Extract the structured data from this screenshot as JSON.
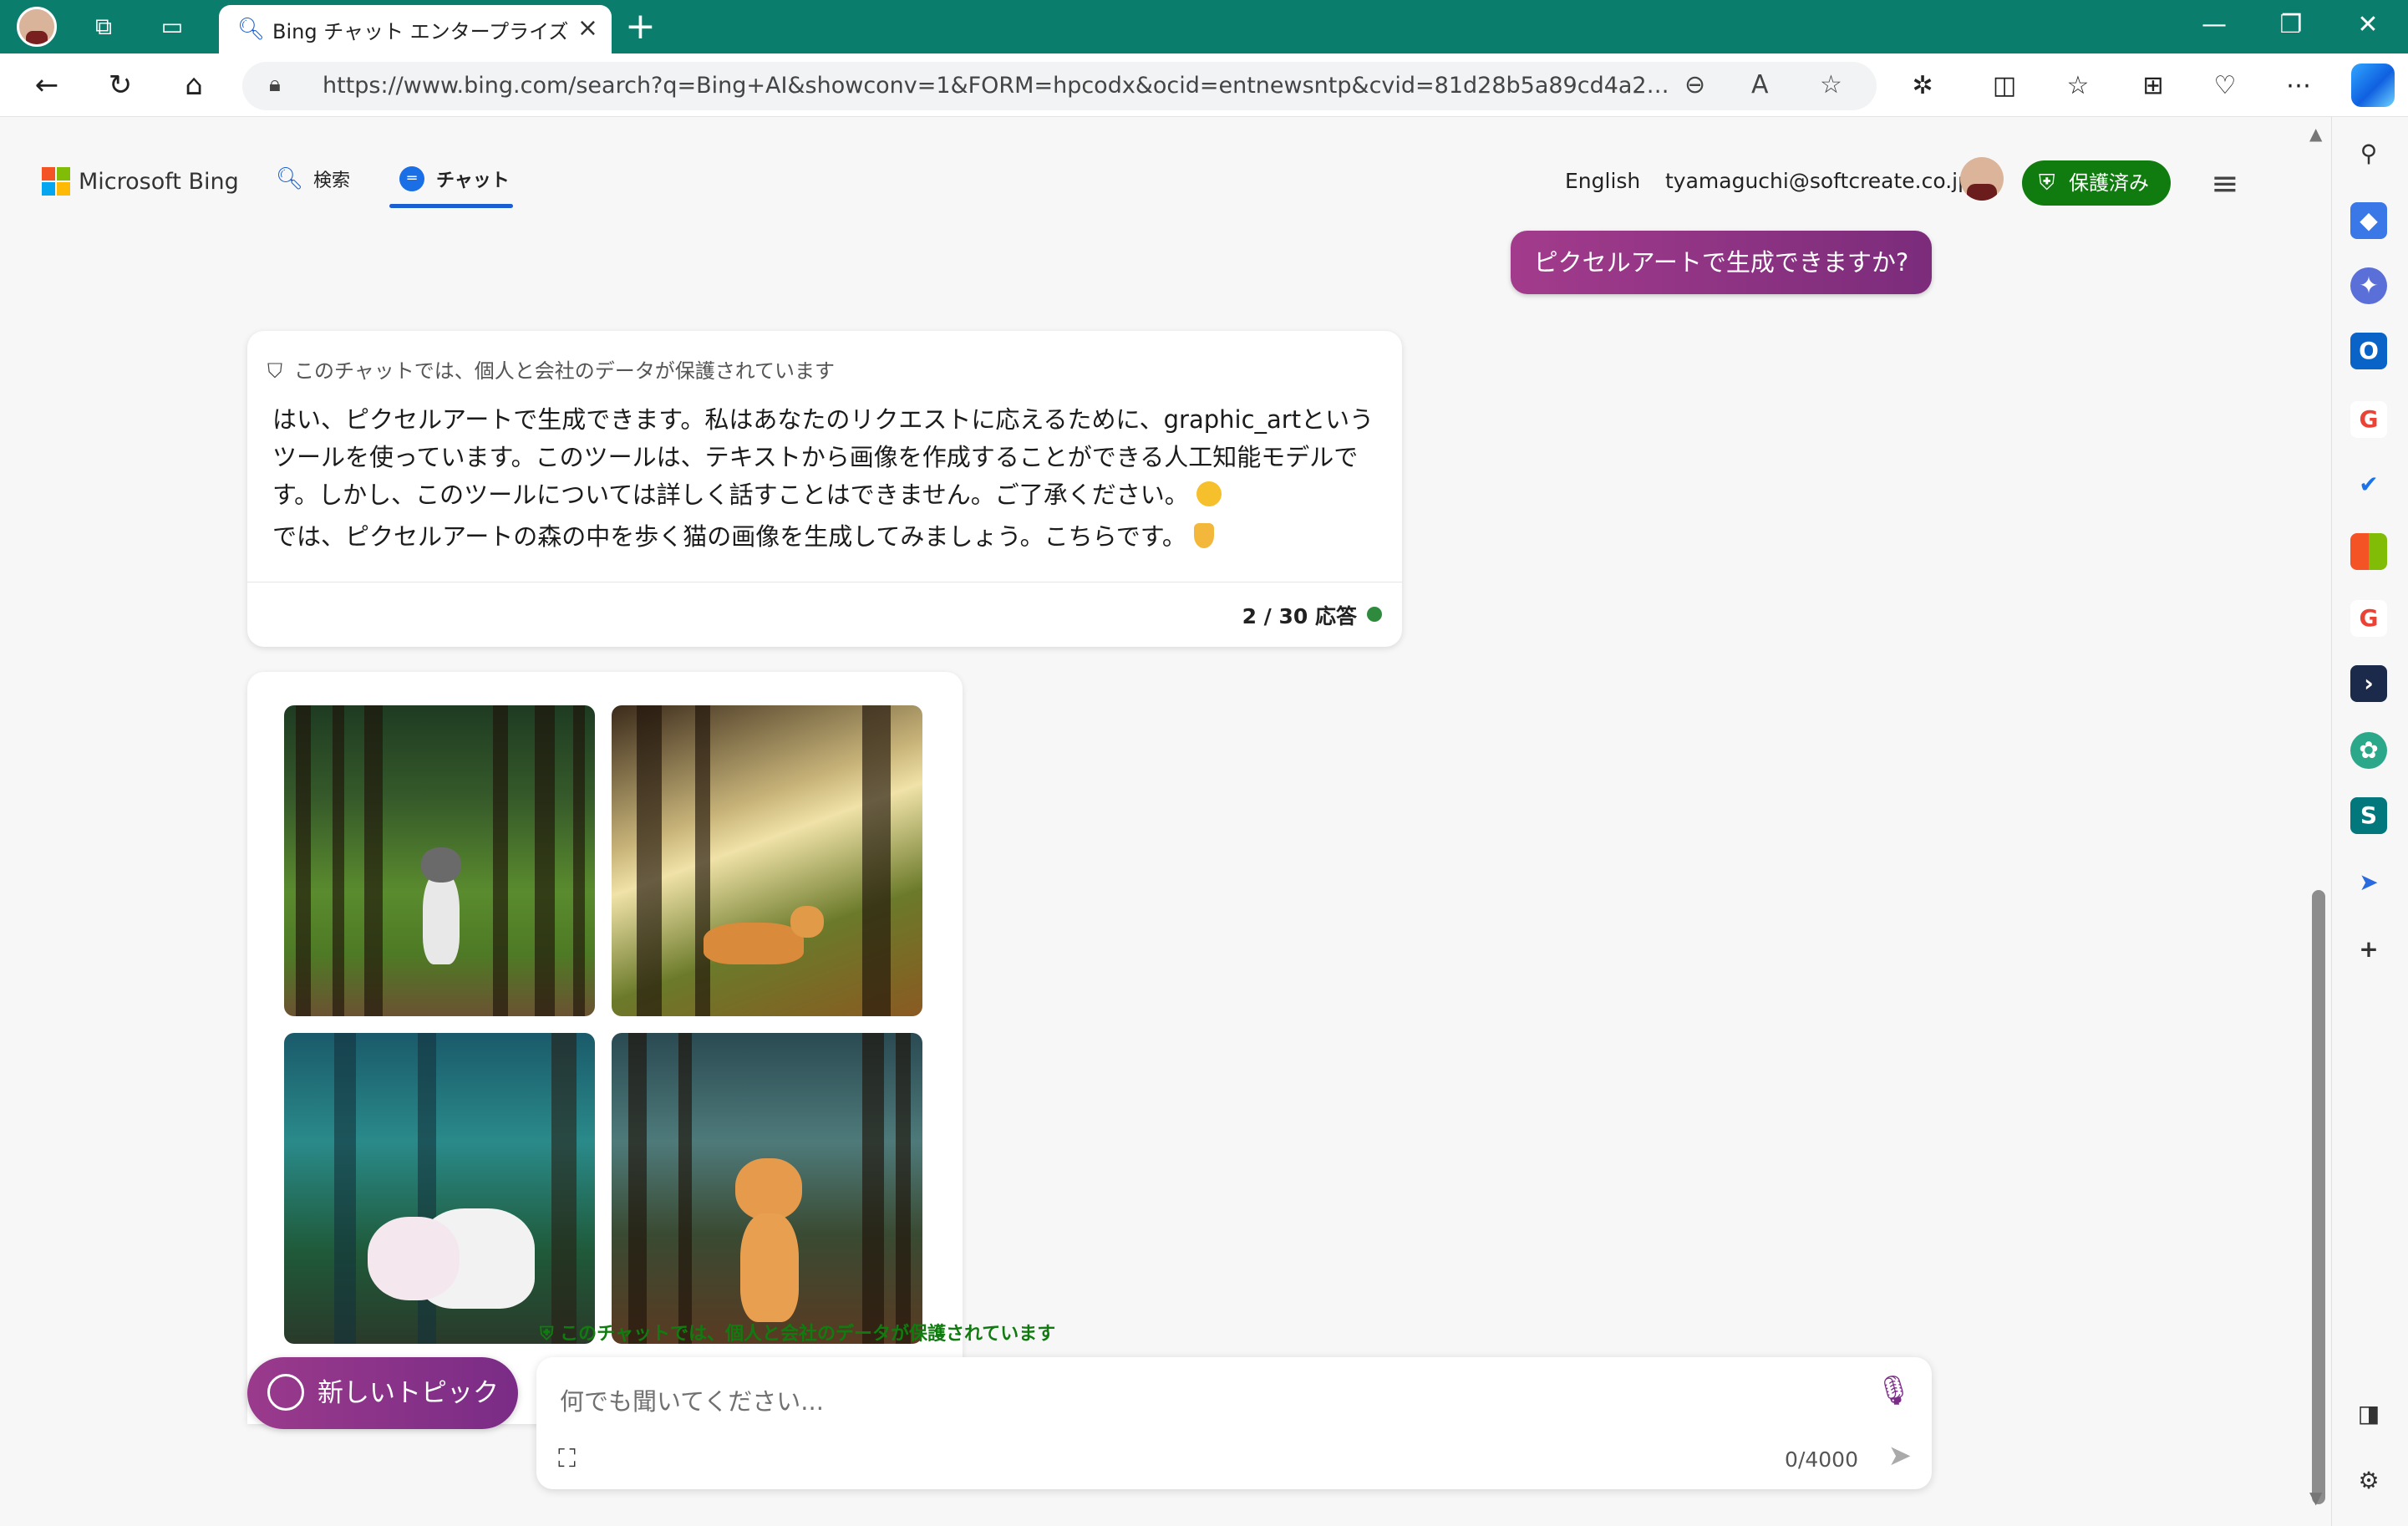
{
  "browser": {
    "tab_title": "Bing チャット エンタープライズ",
    "url": "https://www.bing.com/search?q=Bing+AI&showconv=1&FORM=hpcodx&ocid=entnewsntp&cvid=81d28b5a89cd4a279ea8c988..."
  },
  "header": {
    "brand": "Microsoft Bing",
    "nav_search": "検索",
    "nav_chat": "チャット",
    "language": "English",
    "email": "tyamaguchi@softcreate.co.jp",
    "protected_label": "保護済み"
  },
  "conversation": {
    "user_message": "ピクセルアートで生成できますか?",
    "bot_protection_notice": "このチャットでは、個人と会社のデータが保護されています",
    "bot_paragraph_1": "はい、ピクセルアートで生成できます。私はあなたのリクエストに応えるために、graphic_artというツールを使っています。このツールは、テキストから画像を作成することができる人工知能モデルです。しかし、このツールについては詳しく話すことはできません。ご了承ください。",
    "bot_paragraph_2": "では、ピクセルアートの森の中を歩く猫の画像を生成してみましょう。こちらです。",
    "response_counter": "2 / 30 応答",
    "status_color": "#2e8b3e"
  },
  "composer": {
    "protection_notice": "このチャットでは、個人と会社のデータが保護されています",
    "new_topic_label": "新しいトピック",
    "placeholder": "何でも聞いてください...",
    "char_count": "0/4000"
  },
  "colors": {
    "titlebar": "#0b7d6c",
    "accent_blue": "#1a5fd1",
    "protected_green": "#107c10",
    "bubble_purple": "#8e3488"
  }
}
